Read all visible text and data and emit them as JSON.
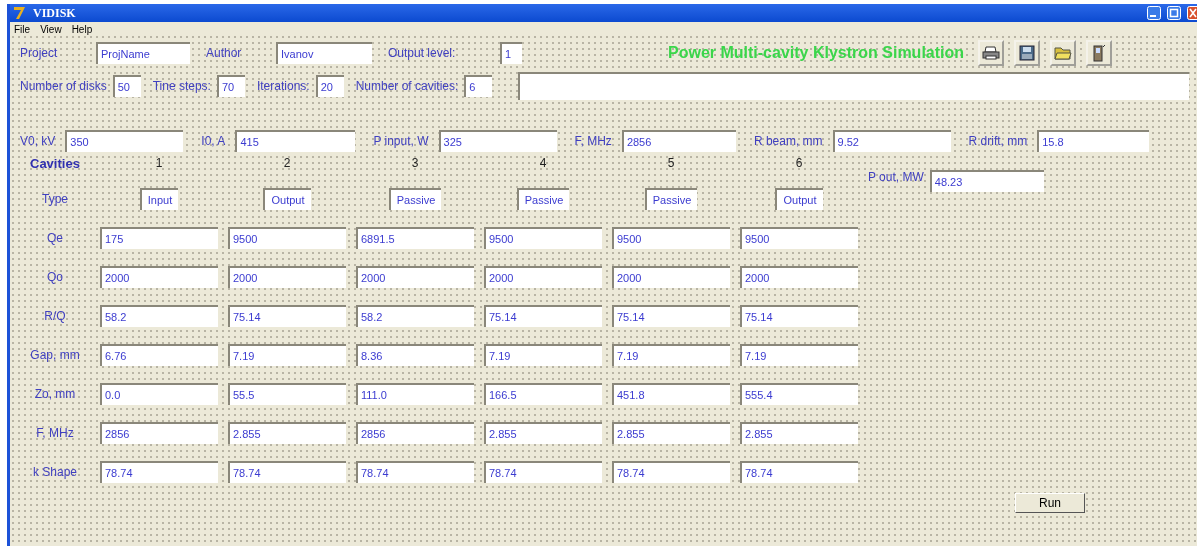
{
  "window": {
    "title": "VIDISK"
  },
  "menu": [
    "File",
    "View",
    "Help"
  ],
  "project_row": {
    "fields": [
      {
        "label": "Project",
        "value": "ProjName"
      },
      {
        "label": "Author",
        "value": "Ivanov"
      },
      {
        "label": "Output level:",
        "value": "1"
      }
    ],
    "heading": "Power Multi-cavity Klystron Simulation"
  },
  "toolbar": [
    {
      "kind": "print"
    },
    {
      "kind": "save"
    },
    {
      "kind": "open"
    },
    {
      "kind": "exit"
    }
  ],
  "settings_row": [
    {
      "label": "Number of disks",
      "value": "50"
    },
    {
      "label": "Tine steps:",
      "value": "70"
    },
    {
      "label": "Iterations:",
      "value": "20"
    },
    {
      "label": "Number of cavities:",
      "value": "6"
    }
  ],
  "beam_row": [
    {
      "label": "V0, kV",
      "value": "350"
    },
    {
      "label": "I0, A",
      "value": "415"
    },
    {
      "label": "P input, W",
      "value": "325"
    },
    {
      "label": "F, MHz",
      "value": "2856"
    },
    {
      "label": "R beam, mm",
      "value": "9.52"
    },
    {
      "label": "R drift, mm",
      "value": "15.8"
    }
  ],
  "cavities": {
    "title": "Cavities",
    "columns": [
      "1",
      "2",
      "3",
      "4",
      "5",
      "6"
    ],
    "type_label": "Type",
    "types": [
      "Input",
      "Output",
      "Passive",
      "Passive",
      "Passive",
      "Output"
    ],
    "rows": [
      {
        "label": "Qe",
        "values": [
          "175",
          "9500",
          "6891.5",
          "9500",
          "9500",
          "9500"
        ]
      },
      {
        "label": "Qo",
        "values": [
          "2000",
          "2000",
          "2000",
          "2000",
          "2000",
          "2000"
        ]
      },
      {
        "label": "R/Q",
        "values": [
          "58.2",
          "75.14",
          "58.2",
          "75.14",
          "75.14",
          "75.14"
        ]
      },
      {
        "label": "Gap, mm",
        "values": [
          "6.76",
          "7.19",
          "8.36",
          "7.19",
          "7.19",
          "7.19"
        ]
      },
      {
        "label": "Zo, mm",
        "values": [
          "0.0",
          "55.5",
          "111.0",
          "166.5",
          "451.8",
          "555.4"
        ]
      },
      {
        "label": "F, MHz",
        "values": [
          "2856",
          "2.855",
          "2856",
          "2.855",
          "2.855",
          "2.855"
        ]
      },
      {
        "label": "k Shape",
        "values": [
          "78.74",
          "78.74",
          "78.74",
          "78.74",
          "78.74",
          "78.74"
        ]
      }
    ]
  },
  "output": {
    "label": "P out, MW",
    "value": "48.23"
  },
  "run_button": "Run"
}
